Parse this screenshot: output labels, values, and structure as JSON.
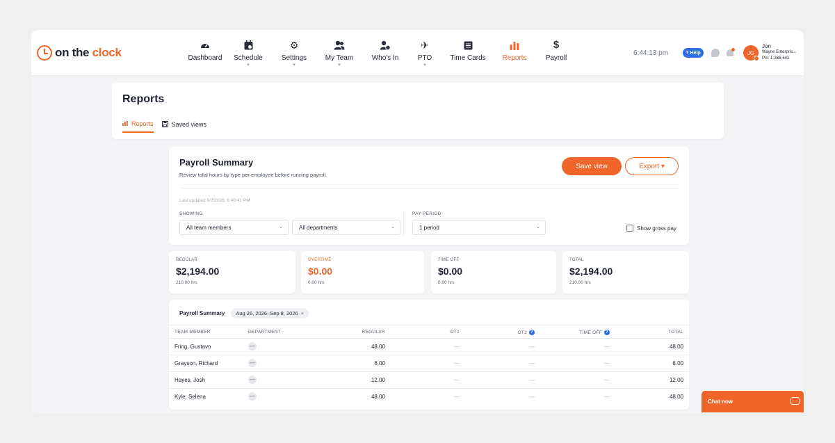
{
  "brand": {
    "logo_prefix": "on the ",
    "logo_accent": "clock"
  },
  "nav": [
    {
      "label": "Dashboard",
      "icon": "dashboard-icon"
    },
    {
      "label": "Schedule",
      "icon": "calendar-icon"
    },
    {
      "label": "Settings",
      "icon": "gears-icon"
    },
    {
      "label": "My Team",
      "icon": "team-icon"
    },
    {
      "label": "Who's In",
      "icon": "whos-in-icon"
    },
    {
      "label": "PTO",
      "icon": "plane-icon"
    },
    {
      "label": "Time Cards",
      "icon": "time-cards-icon"
    },
    {
      "label": "Reports",
      "icon": "bar-chart-icon"
    },
    {
      "label": "Payroll",
      "icon": "dollar-icon"
    }
  ],
  "header": {
    "time": "6:44:13 pm",
    "help": "? Help",
    "avatar_initials": "JG",
    "user_name": "Jon",
    "company": "Wayne Enterpris...",
    "pin": "Pin: 1-288-641"
  },
  "reports_page": {
    "title": "Reports",
    "tabs": [
      {
        "label": "Reports",
        "active": true
      },
      {
        "label": "Saved views",
        "active": false
      }
    ]
  },
  "payroll_summary": {
    "title": "Payroll Summary",
    "subtitle": "Review total hours by type per employee before running payroll.",
    "save_view": "Save view",
    "export": "Export ▾",
    "last_updated": "Last updated 9/7/2026, 6:40:41 PM",
    "showing_label": "SHOWING",
    "team_select": "All team members",
    "dept_select": "All departments",
    "pay_period_label": "PAY PERIOD",
    "period_select": "1 period",
    "show_gross_pay": "Show gross pay"
  },
  "stats": [
    {
      "label": "REGULAR",
      "value": "$2,194.00",
      "hours": "210.00 hrs"
    },
    {
      "label": "OVERTIME",
      "value": "$0.00",
      "hours": "0.00 hrs"
    },
    {
      "label": "TIME OFF",
      "value": "$0.00",
      "hours": "0.00 hrs"
    },
    {
      "label": "TOTAL",
      "value": "$2,194.00",
      "hours": "210.00 hrs"
    }
  ],
  "table": {
    "title": "Payroll Summary",
    "date_chip": "Aug 26, 2026–Sep 8, 2026",
    "chip_close": "×",
    "columns": [
      "TEAM MEMBER",
      "DEPARTMENT",
      "REGULAR",
      "OT1",
      "OT2",
      "TIME OFF",
      "TOTAL"
    ],
    "rows": [
      {
        "name": "Fring, Gustavo",
        "dept": "—",
        "regular": "48.00",
        "ot1": "—",
        "ot2": "—",
        "time_off": "—",
        "total": "48.00"
      },
      {
        "name": "Grayson, Richard",
        "dept": "—",
        "regular": "6.00",
        "ot1": "—",
        "ot2": "—",
        "time_off": "—",
        "total": "6.00"
      },
      {
        "name": "Hayes, Josh",
        "dept": "—",
        "regular": "12.00",
        "ot1": "—",
        "ot2": "—",
        "time_off": "—",
        "total": "12.00"
      },
      {
        "name": "Kyle, Selena",
        "dept": "—",
        "regular": "48.00",
        "ot1": "—",
        "ot2": "—",
        "time_off": "—",
        "total": "48.00"
      }
    ]
  },
  "chat": {
    "label": "Chat now"
  },
  "colors": {
    "accent": "#f0652a",
    "help_blue": "#2f6fe6"
  }
}
